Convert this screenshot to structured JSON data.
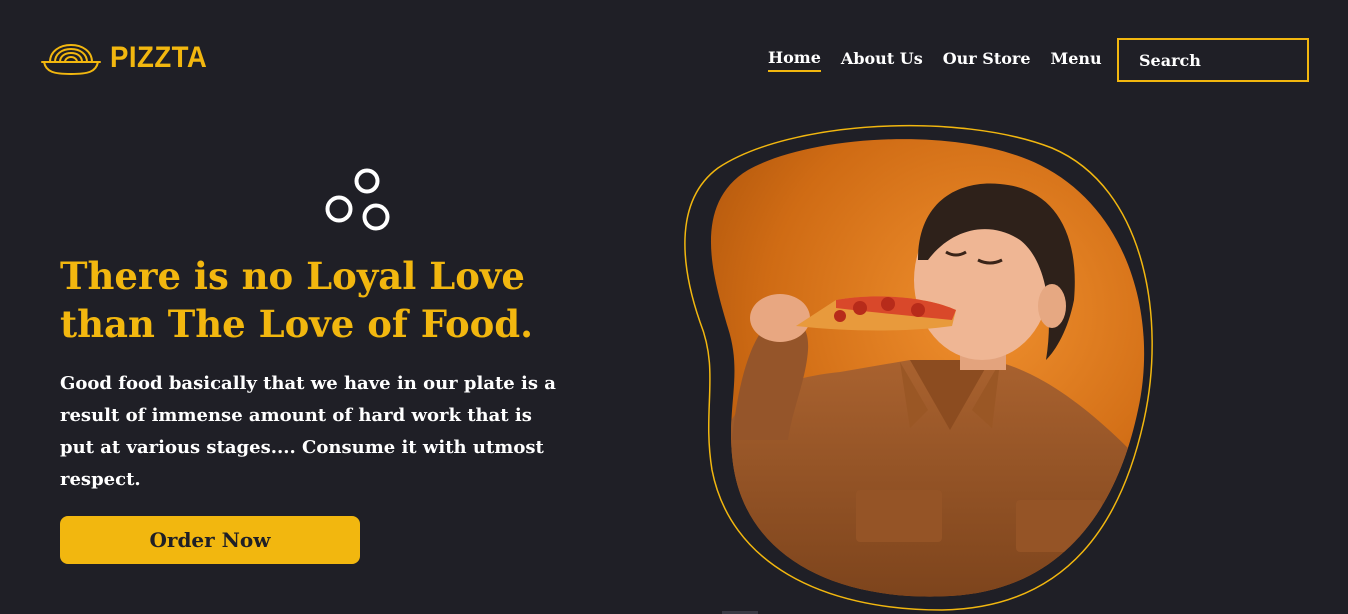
{
  "brand": {
    "name": "PIZZTA",
    "accent_color": "#f2b70f",
    "icon": "pasta-bowl-icon"
  },
  "nav": {
    "items": [
      {
        "label": "Home",
        "active": true
      },
      {
        "label": "About Us",
        "active": false
      },
      {
        "label": "Our Store",
        "active": false
      },
      {
        "label": "Menu",
        "active": false
      }
    ],
    "search": {
      "placeholder": "Search"
    }
  },
  "hero": {
    "headline": "There is no Loyal Love than The Love of Food.",
    "description": "Good food basically that we have in our plate is a result of immense amount of hard work that is put at various stages.... Consume it with utmost respect.",
    "cta_label": "Order Now",
    "decoration_icon": "bubbles-icon",
    "image": "boy-eating-pizza-photo"
  },
  "colors": {
    "background": "#1f1f26",
    "accent": "#f2b70f",
    "text": "#ffffff"
  }
}
